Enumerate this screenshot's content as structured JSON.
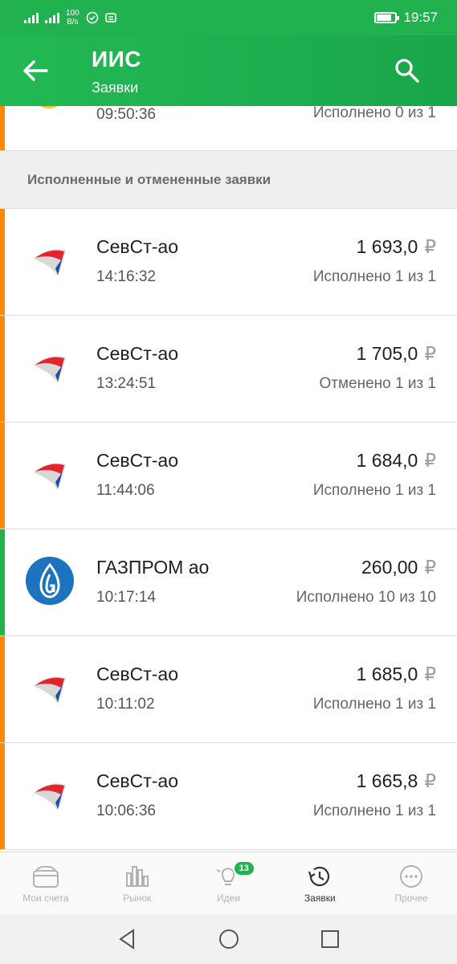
{
  "status_bar": {
    "net_speed_top": "100",
    "net_speed_bottom": "B/s",
    "time": "19:57",
    "battery_level_percent": 80
  },
  "app_bar": {
    "title": "ИИС",
    "subtitle": "Заявки"
  },
  "partial_order": {
    "time": "09:50:36",
    "status": "Исполнено 0 из 1"
  },
  "section_header": "Исполненные и отмененные заявки",
  "currency_symbol": "₽",
  "orders": [
    {
      "name": "СевСт-ао",
      "time": "14:16:32",
      "price": "1 693,0",
      "status": "Исполнено 1 из 1",
      "side": "orange",
      "logo": "severstal-logo"
    },
    {
      "name": "СевСт-ао",
      "time": "13:24:51",
      "price": "1 705,0",
      "status": "Отменено 1 из 1",
      "side": "orange",
      "logo": "severstal-logo"
    },
    {
      "name": "СевСт-ао",
      "time": "11:44:06",
      "price": "1 684,0",
      "status": "Исполнено 1 из 1",
      "side": "orange",
      "logo": "severstal-logo"
    },
    {
      "name": "ГАЗПРОМ ао",
      "time": "10:17:14",
      "price": "260,00",
      "status": "Исполнено 10 из 10",
      "side": "green",
      "logo": "gazprom-logo"
    },
    {
      "name": "СевСт-ао",
      "time": "10:11:02",
      "price": "1 685,0",
      "status": "Исполнено 1 из 1",
      "side": "orange",
      "logo": "severstal-logo"
    },
    {
      "name": "СевСт-ао",
      "time": "10:06:36",
      "price": "1 665,8",
      "status": "Исполнено 1 из 1",
      "side": "orange",
      "logo": "severstal-logo"
    }
  ],
  "bottom_nav": {
    "items": [
      {
        "label": "Мои счета",
        "icon": "wallet-icon"
      },
      {
        "label": "Рынок",
        "icon": "market-chart-icon"
      },
      {
        "label": "Идеи",
        "icon": "lightbulb-icon",
        "badge": "13"
      },
      {
        "label": "Заявки",
        "icon": "history-clock-icon",
        "active": true
      },
      {
        "label": "Прочее",
        "icon": "more-dots-icon"
      }
    ]
  },
  "colors": {
    "brand_green": "#21b24f",
    "sell_orange": "#ff8a00",
    "gazprom_blue": "#1e73be"
  }
}
